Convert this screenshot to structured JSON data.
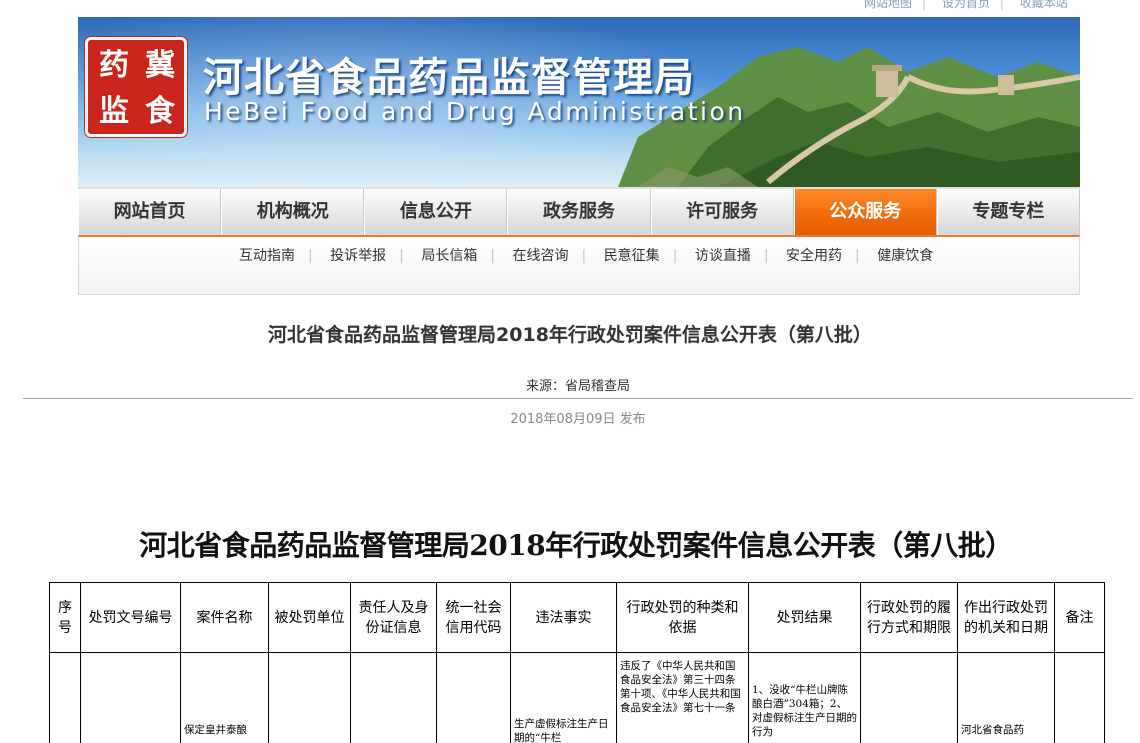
{
  "toplinks": [
    "网站地图",
    "设为首页",
    "收藏本站"
  ],
  "header": {
    "logo_chars": [
      "药",
      "冀",
      "监",
      "食"
    ],
    "title": "河北省食品药品监督管理局",
    "subtitle": "HeBei Food and Drug Administration"
  },
  "nav": {
    "items": [
      "网站首页",
      "机构概况",
      "信息公开",
      "政务服务",
      "许可服务",
      "公众服务",
      "专题专栏"
    ],
    "active": "公众服务"
  },
  "subnav": {
    "items": [
      "互动指南",
      "投诉举报",
      "局长信箱",
      "在线咨询",
      "民意征集",
      "访谈直播",
      "安全用药",
      "健康饮食"
    ]
  },
  "article": {
    "title": "河北省食品药品监督管理局2018年行政处罚案件信息公开表（第八批）",
    "source": "来源：省局稽查局",
    "date": "2018年08月09日  发布"
  },
  "document": {
    "title": "河北省食品药品监督管理局2018年行政处罚案件信息公开表（第八批）",
    "table": {
      "headers": [
        "序号",
        "处罚文号编号",
        "案件名称",
        "被处罚单位",
        "责任人及身份证信息",
        "统一社会信用代码",
        "违法事实",
        "行政处罚的种类和依据",
        "处罚结果",
        "行政处罚的履行方式和期限",
        "作出行政处罚的机关和日期",
        "备注"
      ],
      "row1": {
        "c3": "保定皇井泰酿",
        "c5": "",
        "c7": "生产虚假标注生产日期的“牛栏",
        "c8": "违反了《中华人民共和国食品安全法》第三十四条第十项、《中华人民共和国食品安全法》第七十一条",
        "c9": "1、没收“牛栏山牌陈酿白酒”304箱；2、对虚假标注生产日期的行为",
        "c11": "河北省食品药"
      }
    }
  },
  "colors": {
    "accent_orange": "#f06a0c",
    "logo_red": "#c9251c",
    "banner_blue": "#3f7fcc"
  }
}
